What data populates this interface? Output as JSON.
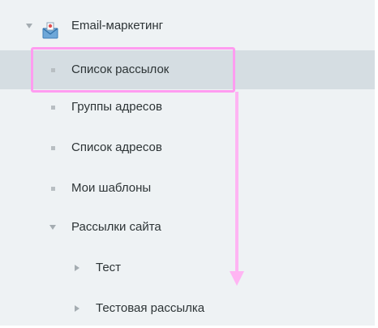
{
  "tree": {
    "root": {
      "label": "Email-маркетинг",
      "expanded": true,
      "icon": "mail-icon"
    },
    "items": [
      {
        "label": "Список рассылок",
        "selected": true
      },
      {
        "label": "Группы адресов"
      },
      {
        "label": "Список адресов"
      },
      {
        "label": "Мои шаблоны"
      },
      {
        "label": "Рассылки сайта",
        "expanded": true,
        "children": [
          {
            "label": "Тест"
          },
          {
            "label": "Тестовая рассылка"
          }
        ]
      }
    ]
  },
  "colors": {
    "panel_bg": "#eef2f4",
    "selected_bg": "#d5dde2",
    "text": "#2d3436",
    "annotation": "#ff9cf0"
  }
}
